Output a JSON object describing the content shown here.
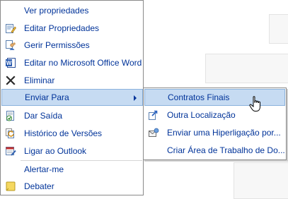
{
  "menu": {
    "items": [
      {
        "label": "Ver propriedades",
        "icon": "none"
      },
      {
        "label": "Editar Propriedades",
        "icon": "edit-properties-icon"
      },
      {
        "label": "Gerir Permissões",
        "icon": "permissions-icon"
      },
      {
        "label": "Editar no Microsoft Office Word",
        "icon": "word-icon"
      },
      {
        "label": "Eliminar",
        "icon": "delete-icon"
      },
      {
        "label": "Enviar Para",
        "icon": "none",
        "submenu_arrow": true,
        "selected": true
      },
      {
        "label": "Dar Saída",
        "icon": "checkout-icon"
      },
      {
        "label": "Histórico de Versões",
        "icon": "version-history-icon"
      },
      {
        "label": "Ligar ao Outlook",
        "icon": "outlook-icon"
      },
      {
        "label": "Alertar-me",
        "icon": "none"
      },
      {
        "label": "Debater",
        "icon": "discussion-icon"
      }
    ]
  },
  "submenu": {
    "items": [
      {
        "label": "Contratos Finais",
        "icon": "none",
        "selected": true
      },
      {
        "label": "Outra Localização",
        "icon": "send-to-other-location-icon"
      },
      {
        "label": "Enviar uma Hiperligação por...",
        "icon": "email-link-icon"
      },
      {
        "label": "Criar Área de Trabalho de Do...",
        "icon": "none"
      }
    ]
  },
  "colors": {
    "text": "#003399",
    "selected_bg": "#c6dbf2",
    "selected_border": "#8bb2dd",
    "menu_border": "#8a8a8a"
  }
}
